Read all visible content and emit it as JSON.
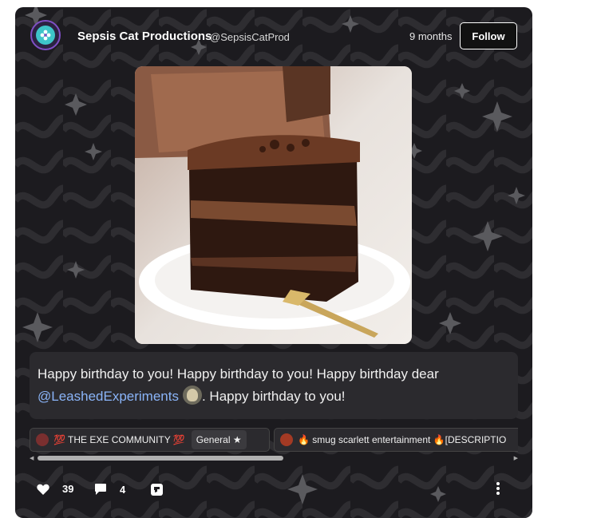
{
  "post": {
    "author_name": "Sepsis Cat Productions",
    "author_handle": "@SepsisCatProd",
    "time": "9 months",
    "follow_label": "Follow",
    "image_alt": "Slice of chocolate layer cake on a white plate with a gold fork",
    "text_before": "Happy birthday to you! Happy birthday to you! Happy birthday dear ",
    "mention": "@LeashedExperiments",
    "text_after": ". Happy birthday to you!"
  },
  "tags": [
    {
      "label": "💯 THE EXE COMMUNITY 💯",
      "sub_label": "General ★",
      "icon_color": "#7a2f2f"
    },
    {
      "label": "🔥 smug scarlett entertainment 🔥[DESCRIPTIO",
      "icon_color": "#a33a24"
    }
  ],
  "actions": {
    "likes": "39",
    "comments": "4"
  },
  "colors": {
    "card_bg": "#1c1b1f",
    "chip_bg": "#2b2a2e",
    "mention": "#8ab4f8"
  }
}
